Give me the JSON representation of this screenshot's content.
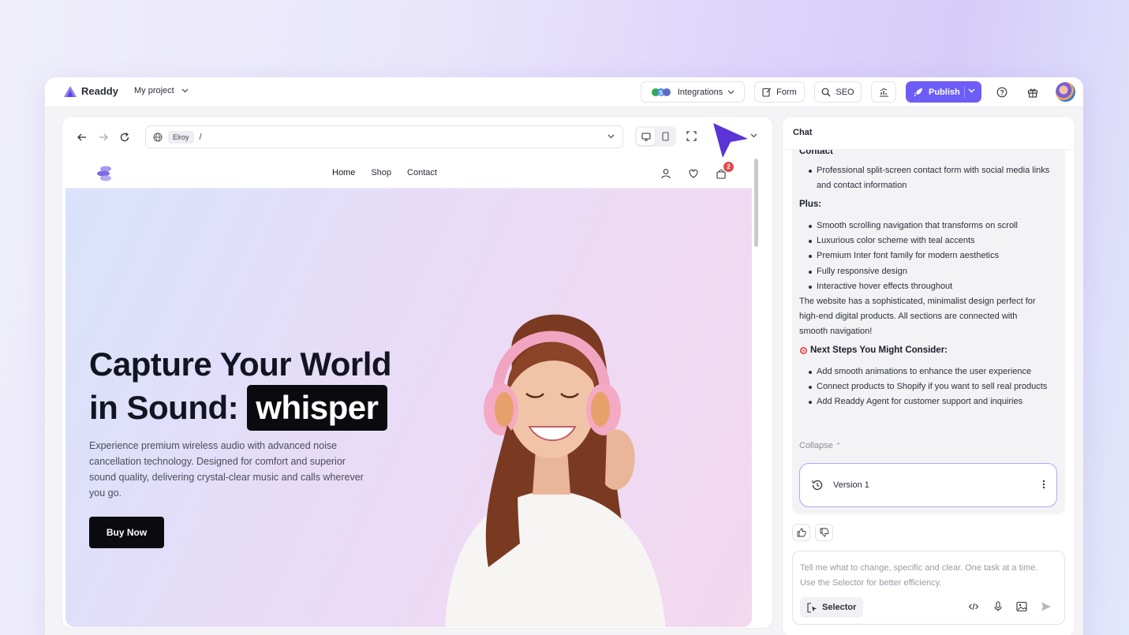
{
  "topbar": {
    "brand": "Readdy",
    "project": "My project",
    "integrations": "Integrations",
    "form": "Form",
    "seo": "SEO",
    "publish": "Publish"
  },
  "browser": {
    "site_chip": "Elroy",
    "path": "/"
  },
  "site": {
    "menu": [
      "Home",
      "Shop",
      "Contact"
    ],
    "cart_count": "2",
    "hero_line1": "Capture Your World",
    "hero_line2": "in Sound:",
    "hero_highlight": "whisper",
    "hero_desc": "Experience premium wireless audio with advanced noise cancellation technology. Designed for comfort and superior sound quality, delivering crystal-clear music and calls wherever you go.",
    "buy_button": "Buy Now"
  },
  "chat": {
    "title": "Chat",
    "contact_heading": "Contact",
    "contact_items": [
      "Professional split-screen contact form with social media links and contact information"
    ],
    "plus_heading": "Plus:",
    "plus_items": [
      "Smooth scrolling navigation that transforms on scroll",
      "Luxurious color scheme with teal accents",
      "Premium Inter font family for modern aesthetics",
      "Fully responsive design",
      "Interactive hover effects throughout"
    ],
    "summary": "The website has a sophisticated, minimalist design perfect for high-end digital products. All sections are connected with smooth navigation!",
    "next_heading": "Next Steps You Might Consider:",
    "next_items": [
      "Add smooth animations to enhance the user experience",
      "Connect products to Shopify if you want to sell real products",
      "Add Readdy Agent for customer support and inquiries"
    ],
    "collapse": "Collapse",
    "version": "Version 1",
    "input_placeholder": "Tell me what to change, specific and clear. One task at a time. Use the Selector for better efficiency.",
    "selector": "Selector"
  },
  "icons": {
    "brand": "readdy-logo-icon",
    "integrations": "integrations-icon",
    "form": "form-icon",
    "seo": "search-icon",
    "analytics": "analytics-icon",
    "publish": "rocket-icon",
    "help": "help-icon",
    "gift": "gift-icon"
  },
  "colors": {
    "accent": "#6d5cf6",
    "version_border": "#b4a6f0",
    "badge": "#e5484d"
  }
}
